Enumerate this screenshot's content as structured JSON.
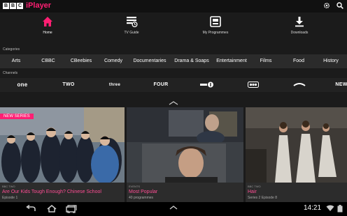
{
  "app": {
    "logo_letters": [
      "B",
      "B",
      "C"
    ],
    "logo_text": "iPlayer",
    "accent": "#ff1f73"
  },
  "topbar": {
    "icons": [
      "gear-icon",
      "search-icon"
    ]
  },
  "nav": [
    {
      "label": "Home",
      "icon": "home-icon",
      "active": true
    },
    {
      "label": "TV Guide",
      "icon": "tv-guide-icon",
      "active": false
    },
    {
      "label": "My Programmes",
      "icon": "my-programmes-icon",
      "active": false
    },
    {
      "label": "Downloads",
      "icon": "download-icon",
      "active": false
    }
  ],
  "categories": {
    "label": "Categories",
    "items": [
      "Arts",
      "CBBC",
      "CBeebies",
      "Comedy",
      "Documentaries",
      "Drama & Soaps",
      "Entertainment",
      "Films",
      "Food",
      "History"
    ]
  },
  "channels": {
    "label": "Channels",
    "items": [
      "one",
      "TWO",
      "three",
      "FOUR",
      "NEW"
    ]
  },
  "cards": [
    {
      "badge": "NEW SERIES",
      "channel": "BBC TWO",
      "title": "Are Our Kids Tough Enough? Chinese School",
      "subtitle": "Episode 1"
    },
    {
      "channel": "EVENTS",
      "title": "Most Popular",
      "subtitle": "40 programmes"
    },
    {
      "channel": "BBC TWO",
      "title": "Hair",
      "subtitle": "Series 2 Episode 8"
    }
  ],
  "system": {
    "time": "14:21"
  }
}
